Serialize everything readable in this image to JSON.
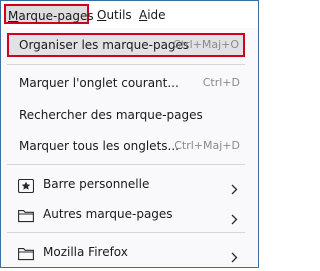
{
  "menubar": {
    "items": [
      {
        "accel": "M",
        "rest": "arque-pages"
      },
      {
        "accel": "O",
        "rest": "utils"
      },
      {
        "accel": "A",
        "rest": "ide"
      }
    ]
  },
  "menu": {
    "organize": {
      "label": "Organiser les marque-pages",
      "shortcut": "Ctrl+Maj+O"
    },
    "bookmark_tab": {
      "label": "Marquer l'onglet courant...",
      "shortcut": "Ctrl+D"
    },
    "search": {
      "label": "Rechercher des marque-pages"
    },
    "bookmark_all": {
      "label": "Marquer tous les onglets...",
      "shortcut": "Ctrl+Maj+D"
    },
    "toolbar": {
      "label": "Barre personnelle",
      "icon": "star-folder-icon"
    },
    "other": {
      "label": "Autres marque-pages",
      "icon": "folder-icon"
    },
    "mozilla": {
      "label": "Mozilla Firefox",
      "icon": "folder-icon"
    }
  }
}
